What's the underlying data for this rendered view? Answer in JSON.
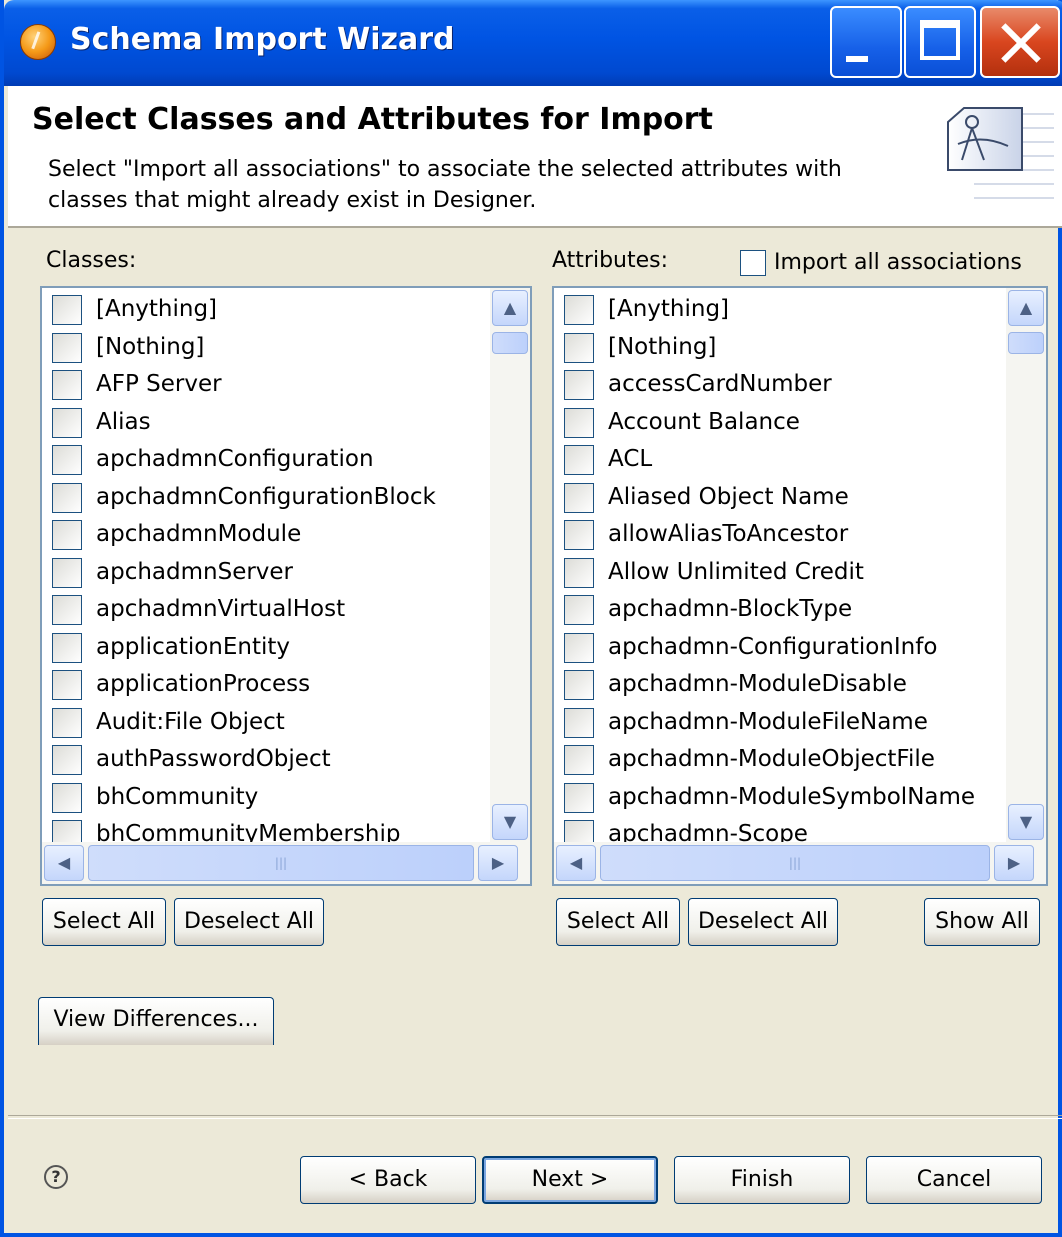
{
  "window": {
    "title": "Schema Import Wizard",
    "accent": "#0054e3"
  },
  "header": {
    "title": "Select Classes and Attributes for Import",
    "description": "Select \"Import all associations\" to associate the selected attributes with classes that might already exist in Designer."
  },
  "classes": {
    "label": "Classes:",
    "items": [
      "[Anything]",
      "[Nothing]",
      "AFP Server",
      "Alias",
      "apchadmnConfiguration",
      "apchadmnConfigurationBlock",
      "apchadmnModule",
      "apchadmnServer",
      "apchadmnVirtualHost",
      "applicationEntity",
      "applicationProcess",
      "Audit:File Object",
      "authPasswordObject",
      "bhCommunity",
      "bhCommunityMembership"
    ],
    "select_all": "Select All",
    "deselect_all": "Deselect All"
  },
  "attributes": {
    "label": "Attributes:",
    "import_all_label": "Import all associations",
    "items": [
      "[Anything]",
      "[Nothing]",
      "accessCardNumber",
      "Account Balance",
      "ACL",
      "Aliased Object Name",
      "allowAliasToAncestor",
      "Allow Unlimited Credit",
      "apchadmn-BlockType",
      "apchadmn-ConfigurationInfo",
      "apchadmn-ModuleDisable",
      "apchadmn-ModuleFileName",
      "apchadmn-ModuleObjectFile",
      "apchadmn-ModuleSymbolName",
      "apchadmn-Scope"
    ],
    "select_all": "Select All",
    "deselect_all": "Deselect All",
    "show_all": "Show All"
  },
  "view_differences": "View Differences...",
  "footer": {
    "back": "< Back",
    "next": "Next >",
    "finish": "Finish",
    "cancel": "Cancel",
    "help_icon": "help-icon"
  }
}
